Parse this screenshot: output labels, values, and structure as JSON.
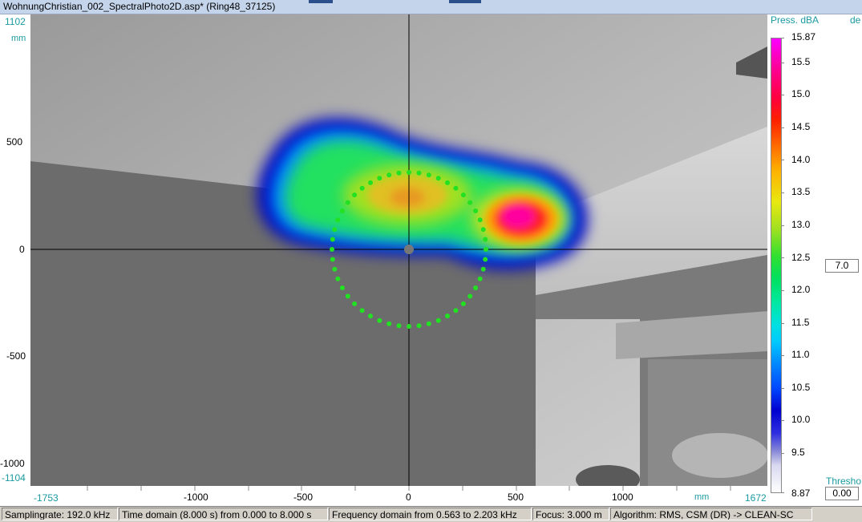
{
  "window": {
    "title": "WohnungChristian_002_SpectralPhoto2D.asp* (Ring48_37125)"
  },
  "y_axis": {
    "top": "1102",
    "unit": "mm",
    "ticks": [
      "500",
      "0",
      "-500",
      "-1000"
    ],
    "bottom": "-1104"
  },
  "x_axis": {
    "left": "-1753",
    "ticks": [
      "-1000",
      "-500",
      "0",
      "500",
      "1000"
    ],
    "unit": "mm",
    "right": "1672"
  },
  "colorbar": {
    "header": "Press. dBA",
    "header2": "de",
    "max": "15.87",
    "min": "8.87",
    "labels": [
      "15.5",
      "15.0",
      "14.5",
      "14.0",
      "13.5",
      "13.0",
      "12.5",
      "12.0",
      "11.5",
      "11.0",
      "10.5",
      "10.0",
      "9.5"
    ],
    "range_value": "7.0",
    "threshold_label": "Thresho",
    "threshold_value": "0.00"
  },
  "status": {
    "samplingrate": "Samplingrate: 192.0 kHz",
    "time_domain": "Time domain (8.000 s) from 0.000 to 8.000 s",
    "freq_domain": "Frequency domain from 0.563 to 2.203 kHz",
    "focus": "Focus: 3.000 m",
    "algorithm": "Algorithm: RMS, CSM (DR) -> CLEAN-SC"
  },
  "colors": {
    "accent": "#1a9aa0",
    "array_dots": "#22e022"
  }
}
